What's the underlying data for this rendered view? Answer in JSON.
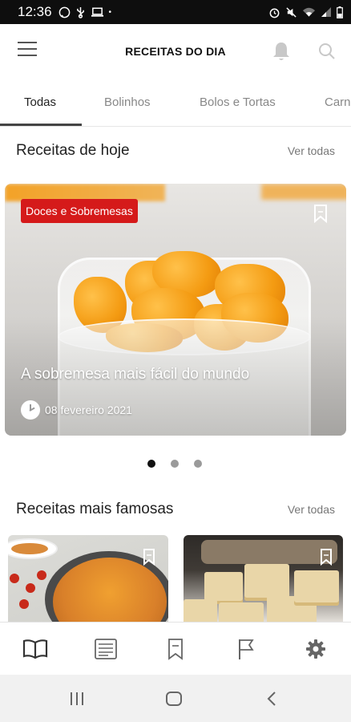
{
  "status_bar": {
    "time": "12:36",
    "icons": [
      "whatsapp-icon",
      "usb-icon",
      "laptop-icon",
      "dot-icon"
    ],
    "right_icons": [
      "alarm-icon",
      "mute-icon",
      "wifi-icon",
      "signal-icon",
      "battery-icon"
    ]
  },
  "app_bar": {
    "title": "RECEITAS DO DIA"
  },
  "tabs": [
    {
      "label": "Todas",
      "active": true
    },
    {
      "label": "Bolinhos",
      "active": false
    },
    {
      "label": "Bolos e Tortas",
      "active": false
    },
    {
      "label": "Carn",
      "active": false
    }
  ],
  "today": {
    "title": "Receitas de hoje",
    "see_all": "Ver todas",
    "featured": {
      "category": "Doces e Sobremesas",
      "title": "A sobremesa mais fácil do mundo",
      "date": "08 fevereiro 2021"
    },
    "carousel": {
      "pages": 3,
      "active_page": 1
    }
  },
  "famous": {
    "title": "Receitas mais famosas",
    "see_all": "Ver todas",
    "cards": [
      {
        "image": "stew-dish-photo"
      },
      {
        "image": "cake-squares-photo"
      }
    ]
  },
  "bottom_nav": [
    "recipes-book-icon",
    "news-icon",
    "bookmarks-icon",
    "flag-icon",
    "settings-icon"
  ],
  "colors": {
    "badge": "#d51a1a",
    "accent": "#444444"
  }
}
